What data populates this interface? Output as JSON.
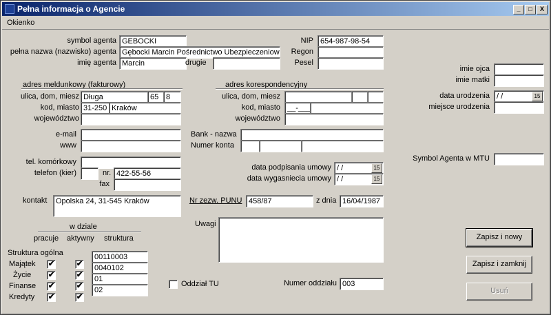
{
  "window": {
    "title": "Pełna informacja o Agencie",
    "min_btn": "_",
    "max_btn": "□",
    "close_btn": "X"
  },
  "menu": {
    "okienko": "Okienko"
  },
  "agent": {
    "symbol_label": "symbol agenta",
    "symbol": "GEBOCKI",
    "full_name_label": "pełna nazwa (nazwisko) agenta",
    "full_name": "Gębocki Marcin Pośrednictwo Ubezpieczeniowe",
    "first_name_label": "imię agenta",
    "first_name": "Marcin",
    "second_label": "drugie",
    "second_name": "",
    "nip_label": "NIP",
    "nip": "654-987-98-54",
    "regon_label": "Regon",
    "regon": "",
    "pesel_label": "Pesel",
    "pesel": ""
  },
  "address_main": {
    "header": "adres meldunkowy (fakturowy)",
    "street_label": "ulica, dom, miesz",
    "street": "Długa",
    "house": "65",
    "flat": "8",
    "zip_label": "kod, miasto",
    "zip": "31-250",
    "city": "Kraków",
    "voiv_label": "województwo",
    "voivodeship": ""
  },
  "address_corr": {
    "header": "adres korespondencyjny",
    "street_label": "ulica, dom, miesz",
    "street": "",
    "house": "",
    "flat": "",
    "zip_label": "kod, miasto",
    "zip": "__-___",
    "city": "",
    "voiv_label": "województwo",
    "voivodeship": ""
  },
  "personal": {
    "father_label": "imie ojca",
    "father": "",
    "mother_label": "imie matki",
    "mother": "",
    "birth_date_label": "data urodzenia",
    "birth_date": " / /",
    "birth_place_label": "miejsce urodzenia",
    "birth_place": "",
    "mtu_label": "Symbol Agenta w MTU",
    "mtu": ""
  },
  "contact": {
    "email_label": "e-mail",
    "email": "",
    "www_label": "www",
    "www": "",
    "mobile_label": "tel. komórkowy",
    "mobile": "",
    "phone_label": "telefon (kier)",
    "phone_prefix": "",
    "nr_label": "nr.",
    "phone": "422-55-56",
    "fax_label": "fax",
    "fax": "",
    "contact_label": "kontakt",
    "contact": "Opolska 24, 31-545 Kraków"
  },
  "bank": {
    "name_label": "Bank - nazwa",
    "name": "",
    "account_label": "Numer konta"
  },
  "contract": {
    "signed_label": "data podpisania umowy",
    "signed": " / /",
    "expiry_label": "data wygasniecia umowy",
    "expiry": " / /",
    "punu_label": "Nr zezw. PUNU",
    "punu": "458/87",
    "from_label": "z dnia",
    "from_date": "16/04/1987",
    "notes_label": "Uwagi",
    "notes": ""
  },
  "departments": {
    "header": "w dziale",
    "col_works": "pracuje",
    "col_active": "aktywny",
    "col_structure": "struktura",
    "general_label": "Struktura ogólna",
    "rows": [
      {
        "label": "Majątek",
        "works": "✔",
        "active": "✔",
        "structure": "00110003"
      },
      {
        "label": "Życie",
        "works": "✔",
        "active": "✔",
        "structure": "0040102"
      },
      {
        "label": "Finanse",
        "works": "✔",
        "active": "✔",
        "structure": "01"
      },
      {
        "label": "Kredyty",
        "works": "✔",
        "active": "✔",
        "structure": "02"
      }
    ]
  },
  "branch": {
    "tu_label": "Oddział TU",
    "tu_checked": "",
    "number_label": "Numer oddziału",
    "number": "003"
  },
  "buttons": {
    "save_new": "Zapisz i nowy",
    "save_close": "Zapisz i zamknij",
    "delete": "Usuń"
  },
  "icons": {
    "calendar": "15"
  }
}
